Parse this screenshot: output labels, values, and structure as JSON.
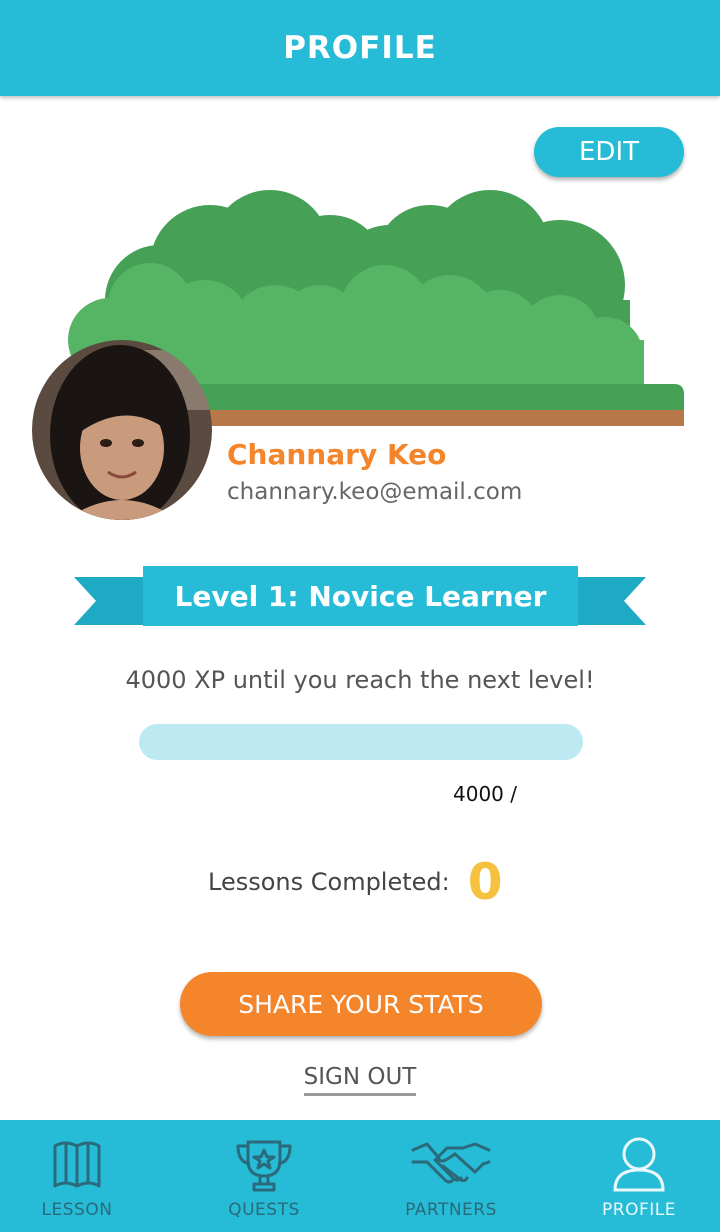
{
  "header": {
    "title": "PROFILE"
  },
  "profile": {
    "edit_label": "EDIT",
    "name": "Channary Keo",
    "email": "channary.keo@email.com"
  },
  "level": {
    "title": "Level 1: Novice Learner",
    "xp_message": "4000 XP until you reach the next level!",
    "xp_count": "4000 /",
    "progress_fraction": 0
  },
  "stats": {
    "lessons_label": "Lessons Completed:",
    "lessons_count": "0"
  },
  "actions": {
    "share_label": "SHARE YOUR STATS",
    "sign_out_label": "SIGN OUT"
  },
  "nav": {
    "items": [
      {
        "label": "LESSON",
        "icon": "book-icon"
      },
      {
        "label": "QUESTS",
        "icon": "trophy-icon"
      },
      {
        "label": "PARTNERS",
        "icon": "handshake-icon"
      },
      {
        "label": "PROFILE",
        "icon": "user-icon"
      }
    ],
    "active": "PROFILE"
  },
  "colors": {
    "primary": "#26bcd7",
    "accent": "#f4852b",
    "highlight": "#f5c13e",
    "progress_track": "#bdeaf2"
  }
}
